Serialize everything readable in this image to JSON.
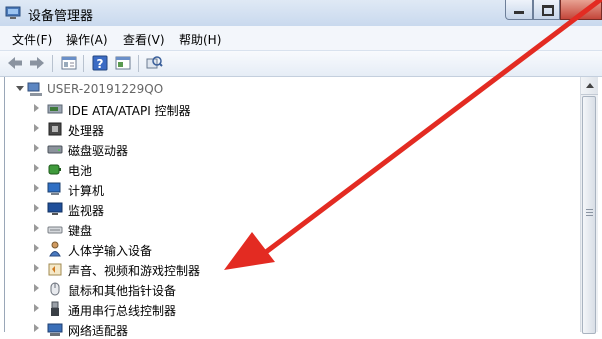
{
  "window": {
    "title": "设备管理器"
  },
  "menu": [
    "文件(F)",
    "操作(A)",
    "查看(V)",
    "帮助(H)"
  ],
  "tree": {
    "root_label": "USER-20191229QO",
    "items": [
      {
        "label": "IDE ATA/ATAPI 控制器",
        "icon": "ide-controller-icon"
      },
      {
        "label": "处理器",
        "icon": "processor-icon"
      },
      {
        "label": "磁盘驱动器",
        "icon": "disk-drive-icon"
      },
      {
        "label": "电池",
        "icon": "battery-icon"
      },
      {
        "label": "计算机",
        "icon": "computer-icon"
      },
      {
        "label": "监视器",
        "icon": "monitor-icon"
      },
      {
        "label": "键盘",
        "icon": "keyboard-icon"
      },
      {
        "label": "人体学输入设备",
        "icon": "hid-icon"
      },
      {
        "label": "声音、视频和游戏控制器",
        "icon": "sound-icon"
      },
      {
        "label": "鼠标和其他指针设备",
        "icon": "mouse-icon"
      },
      {
        "label": "通用串行总线控制器",
        "icon": "usb-icon"
      },
      {
        "label": "网络适配器",
        "icon": "network-adapter-icon"
      }
    ]
  },
  "colors": {
    "arrow": "#e32b22",
    "titlebar": "#c9d9ee"
  }
}
